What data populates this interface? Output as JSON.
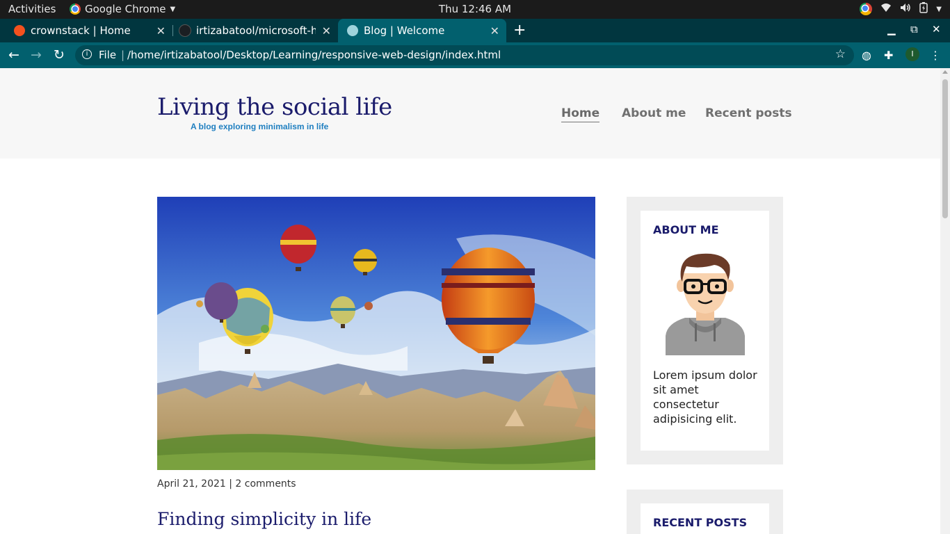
{
  "os": {
    "activities": "Activities",
    "app_name": "Google Chrome",
    "clock": "Thu 12:46 AM"
  },
  "browser": {
    "tabs": [
      {
        "title": "crownstack | Home",
        "icon": "crownstack-favicon",
        "color": "#f4511e"
      },
      {
        "title": "irtizabatool/microsoft-ho",
        "icon": "github-favicon",
        "color": "#1b1f23"
      },
      {
        "title": "Blog | Welcome",
        "icon": "globe-favicon",
        "color": "#9fd3dc",
        "active": true
      }
    ],
    "omnibox": {
      "scheme_label": "File",
      "url": "/home/irtizabatool/Desktop/Learning/responsive-web-design/index.html"
    },
    "profile_initial": "I"
  },
  "page": {
    "site_title": "Living the social life",
    "site_subtitle": "A blog exploring minimalism in life",
    "nav": [
      {
        "label": "Home",
        "current": true
      },
      {
        "label": "About me"
      },
      {
        "label": "Recent posts"
      }
    ],
    "post": {
      "date": "April 21, 2021",
      "separator": "|",
      "comments": "2 comments",
      "title": "Finding simplicity in life"
    },
    "sidebar": {
      "about_heading": "ABOUT ME",
      "about_text": "Lorem ipsum dolor sit amet consectetur adipisicing elit.",
      "recent_heading": "RECENT POSTS"
    }
  },
  "colors": {
    "tab_strip": "#01363f",
    "toolbar": "#02606e",
    "title_blue": "#1a1b6b",
    "subtitle_blue": "#1f7fc0"
  }
}
